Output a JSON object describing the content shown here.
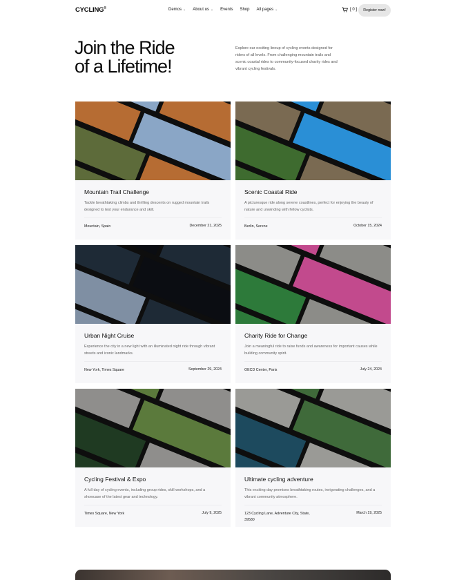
{
  "header": {
    "logo": "CYCLING",
    "logo_mark": "®",
    "nav": [
      {
        "label": "Demos",
        "has_dropdown": true
      },
      {
        "label": "About us",
        "has_dropdown": true
      },
      {
        "label": "Events",
        "has_dropdown": false
      },
      {
        "label": "Shop",
        "has_dropdown": false
      },
      {
        "label": "All pages",
        "has_dropdown": true
      }
    ],
    "cart_count": "[ 0 ]",
    "register_label": "Register now!"
  },
  "hero": {
    "title_line1": "Join the Ride",
    "title_line2": "of a Lifetime!",
    "description": "Explore our exciting lineup of cycling events designed for riders of all levels. From challenging mountain trails and scenic coastal rides to community-focused charity rides and vibrant cycling festivals."
  },
  "events": [
    {
      "title": "Mountain Trail Challenge",
      "description": "Tackle breathtaking climbs and thrilling descents on rugged mountain trails designed to test your endurance and skill.",
      "location": "Mountain, Spain",
      "date": "December 21, 2025",
      "palette": [
        "#8aa6c6",
        "#b66c33",
        "#5d6b3a"
      ]
    },
    {
      "title": "Scenic Coastal Ride",
      "description": "A picturesque ride along serene coastlines, perfect for enjoying the beauty of nature and unwinding with fellow cyclists.",
      "location": "Berlin, Serene",
      "date": "October 15, 2024",
      "palette": [
        "#2a8fd6",
        "#7a6a52",
        "#3e6b2f"
      ]
    },
    {
      "title": "Urban Night Cruise",
      "description": "Experience the city in a new light with an illuminated night ride through vibrant streets and iconic landmarks.",
      "location": "New York, Times Square",
      "date": "September 29, 2024",
      "palette": [
        "#0b0d12",
        "#1e2a36",
        "#7f8fa3"
      ]
    },
    {
      "title": "Charity Ride for Change",
      "description": "Join a meaningful ride to raise funds and awareness for important causes while building community spirit.",
      "location": "OECD Center, Paris",
      "date": "July 24, 2024",
      "palette": [
        "#c24a8d",
        "#8c8c88",
        "#2d7a3a"
      ]
    },
    {
      "title": "Cycling Festival & Expo",
      "description": "A full day of cycling events, including group rides, skill workshops, and a showcase of the latest gear and technology.",
      "location": "Times Square, New York",
      "date": "July 9, 2025",
      "palette": [
        "#5b7a3c",
        "#8f8e8c",
        "#1f3a22"
      ]
    },
    {
      "title": "Ultimate cycling adventure",
      "description": "This exciting day promises breathtaking routes, invigorating challenges, and a vibrant community atmosphere.",
      "location": "123 Cycling Lane, Adventure City, State, 39580",
      "date": "March 19, 2025",
      "palette": [
        "#3f6a3a",
        "#9a9a96",
        "#1d4a5e"
      ]
    }
  ]
}
